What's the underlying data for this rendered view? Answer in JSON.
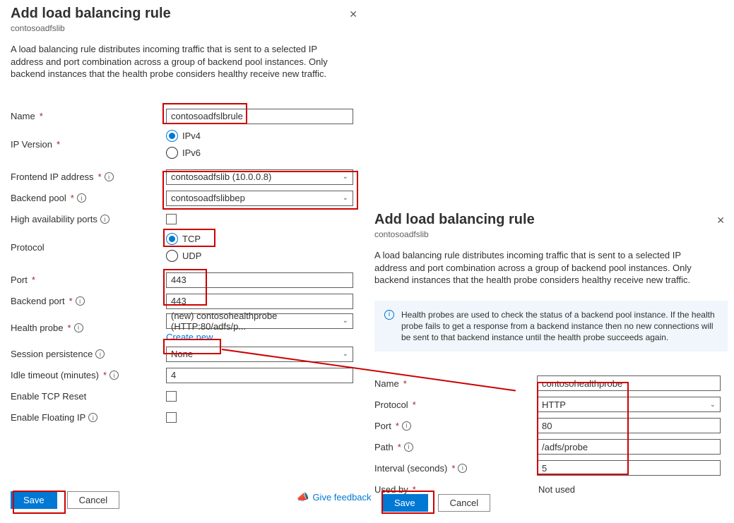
{
  "left": {
    "title": "Add load balancing rule",
    "subtitle": "contosoadfslib",
    "description": "A load balancing rule distributes incoming traffic that is sent to a selected IP address and port combination across a group of backend pool instances. Only backend instances that the health probe considers healthy receive new traffic.",
    "labels": {
      "name": "Name",
      "ipversion": "IP Version",
      "frontend": "Frontend IP address",
      "backendpool": "Backend pool",
      "haports": "High availability ports",
      "protocol": "Protocol",
      "port": "Port",
      "backendport": "Backend port",
      "healthprobe": "Health probe",
      "createnew": "Create new",
      "session": "Session persistence",
      "idle": "Idle timeout (minutes)",
      "tcpreset": "Enable TCP Reset",
      "floating": "Enable Floating IP"
    },
    "values": {
      "name": "contosoadfslbrule",
      "ipv4": "IPv4",
      "ipv6": "IPv6",
      "frontend": "contosoadfslib (10.0.0.8)",
      "backendpool": "contosoadfslibbep",
      "tcp": "TCP",
      "udp": "UDP",
      "port": "443",
      "backendport": "443",
      "healthprobe": "(new) contosohealthprobe (HTTP:80/adfs/p...",
      "session": "None",
      "idle": "4"
    },
    "footer": {
      "save": "Save",
      "cancel": "Cancel",
      "feedback": "Give feedback"
    }
  },
  "right": {
    "title": "Add load balancing rule",
    "subtitle": "contosoadfslib",
    "description": "A load balancing rule distributes incoming traffic that is sent to a selected IP address and port combination across a group of backend pool instances. Only backend instances that the health probe considers healthy receive new traffic.",
    "infobox": "Health probes are used to check the status of a backend pool instance. If the health probe fails to get a response from a backend instance then no new connections will be sent to that backend instance until the health probe succeeds again.",
    "labels": {
      "name": "Name",
      "protocol": "Protocol",
      "port": "Port",
      "path": "Path",
      "interval": "Interval (seconds)",
      "usedby": "Used by"
    },
    "values": {
      "name": "contosohealthprobe",
      "protocol": "HTTP",
      "port": "80",
      "path": "/adfs/probe",
      "interval": "5",
      "usedby": "Not used"
    },
    "footer": {
      "save": "Save",
      "cancel": "Cancel"
    }
  }
}
